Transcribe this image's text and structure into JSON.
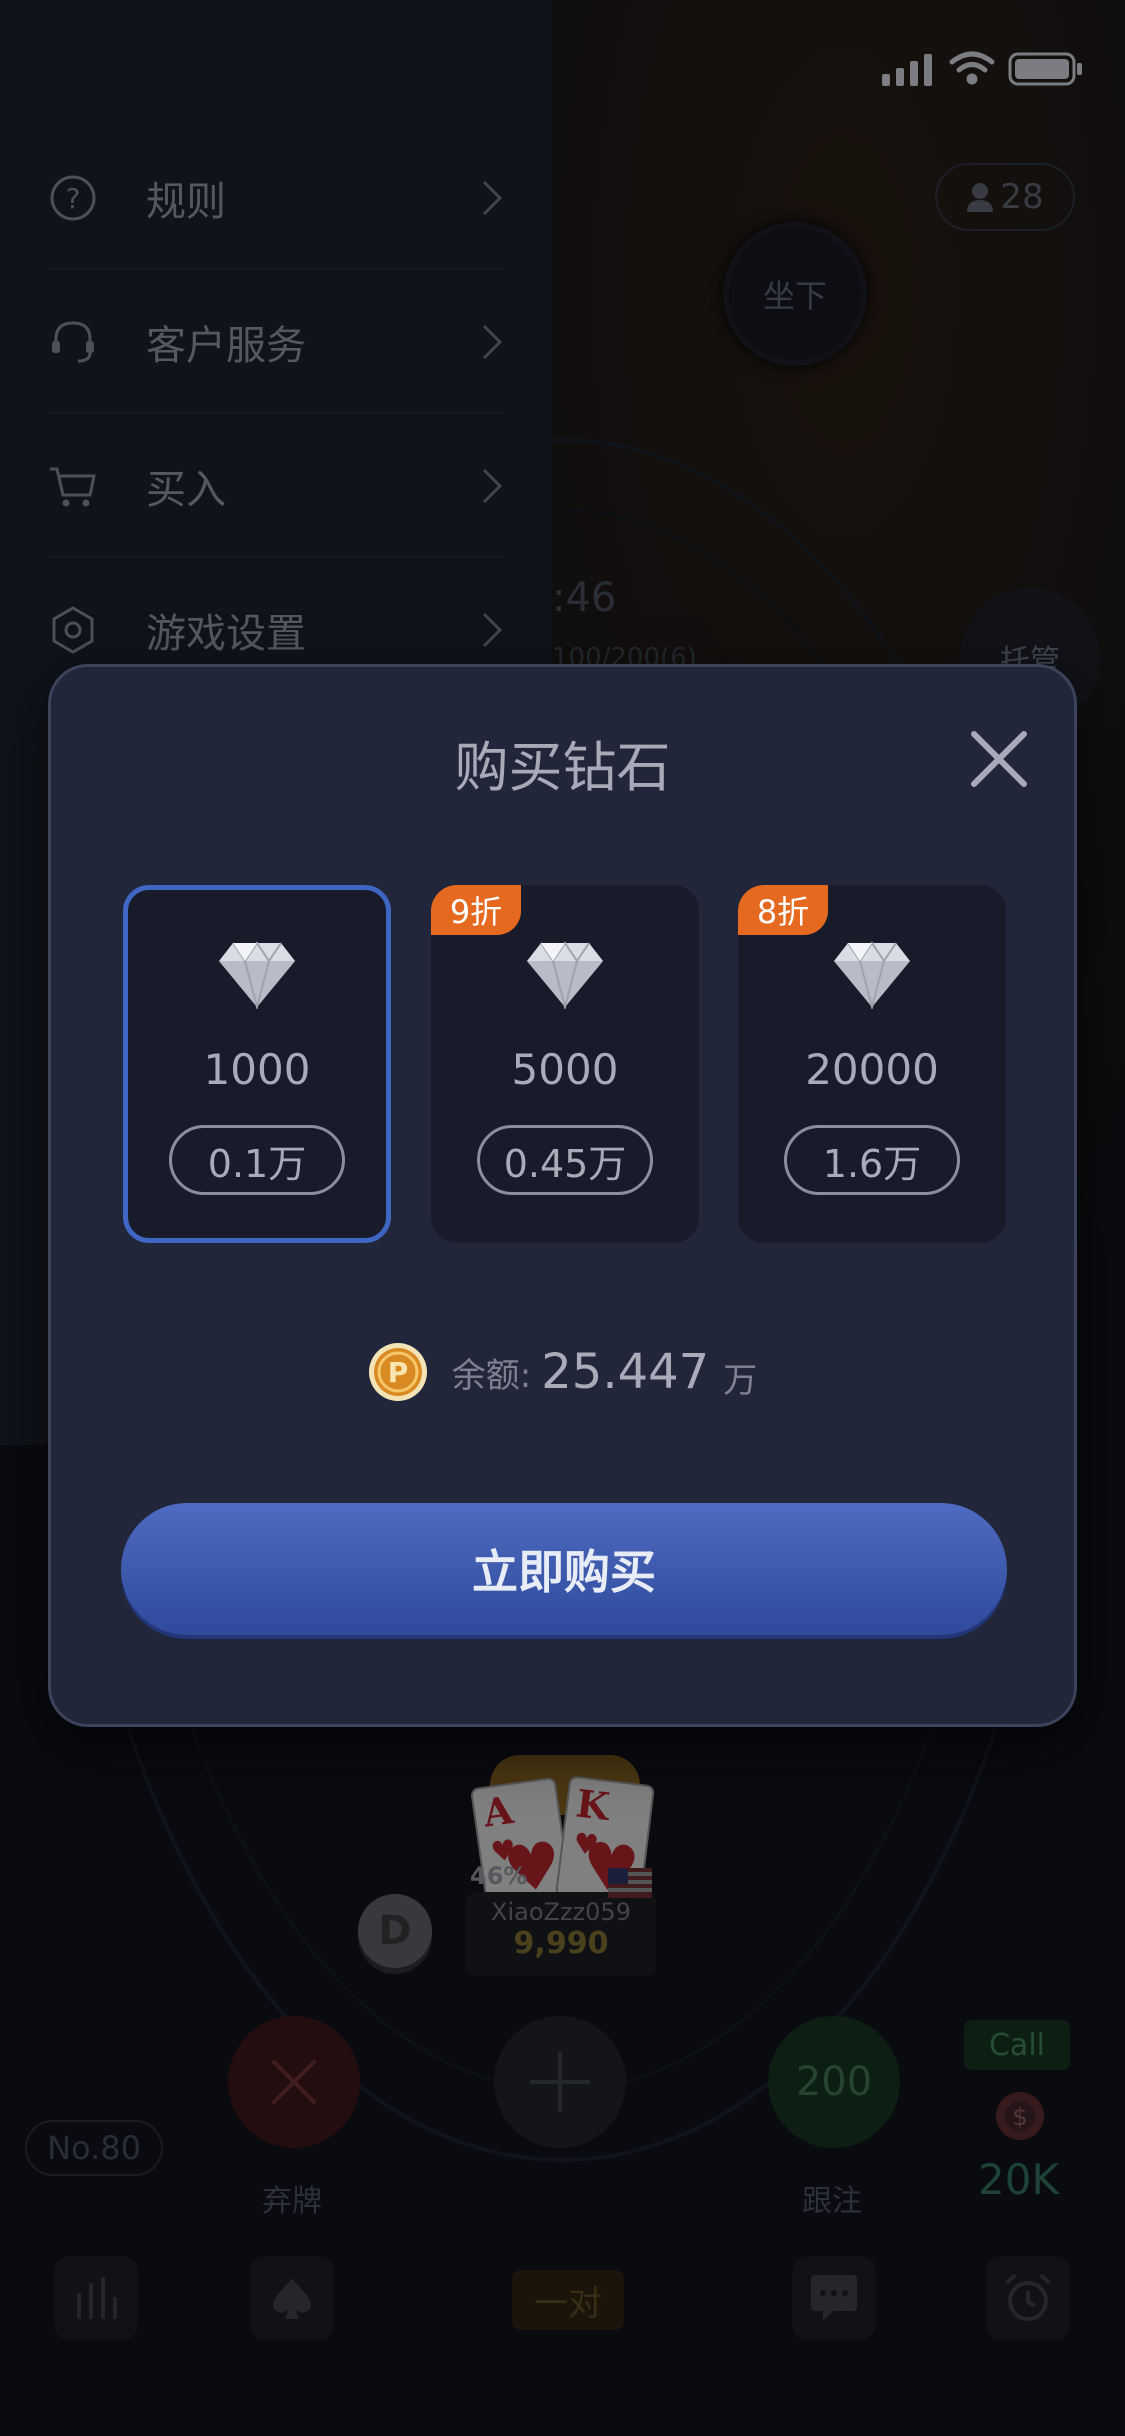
{
  "side_menu": {
    "items": [
      {
        "label": "规则",
        "icon": "help-circle-icon"
      },
      {
        "label": "客户服务",
        "icon": "headset-icon"
      },
      {
        "label": "买入",
        "icon": "cart-icon"
      },
      {
        "label": "游戏设置",
        "icon": "hexagon-settings-icon"
      }
    ]
  },
  "table": {
    "player_count": "28",
    "sit_label": "坐下",
    "timer": ":46",
    "blinds": "100/200(6)",
    "host_label": "托管",
    "hero": {
      "name": "XiaoZzz059",
      "chips": "9,990",
      "win_percent": "46%",
      "cards": [
        {
          "rank": "A",
          "suit": "♥"
        },
        {
          "rank": "K",
          "suit": "♥"
        }
      ]
    },
    "dealer_label": "D",
    "table_number": "No.80",
    "fold_label": "弃牌",
    "call_value": "200",
    "call_label": "跟注",
    "call_tag": "Call",
    "call_amount": "20K",
    "hand_rank": "一对"
  },
  "modal": {
    "title": "购买钻石",
    "packages": [
      {
        "amount": "1000",
        "price": "0.1万",
        "discount": "",
        "selected": true
      },
      {
        "amount": "5000",
        "price": "0.45万",
        "discount": "9折",
        "selected": false
      },
      {
        "amount": "20000",
        "price": "1.6万",
        "discount": "8折",
        "selected": false
      }
    ],
    "balance_label": "余额:",
    "balance_value": "25.447",
    "balance_unit": "万",
    "buy_label": "立即购买"
  },
  "colors": {
    "accent": "#3f66c2",
    "discount": "#e56a20",
    "modal_bg": "#21263a"
  }
}
